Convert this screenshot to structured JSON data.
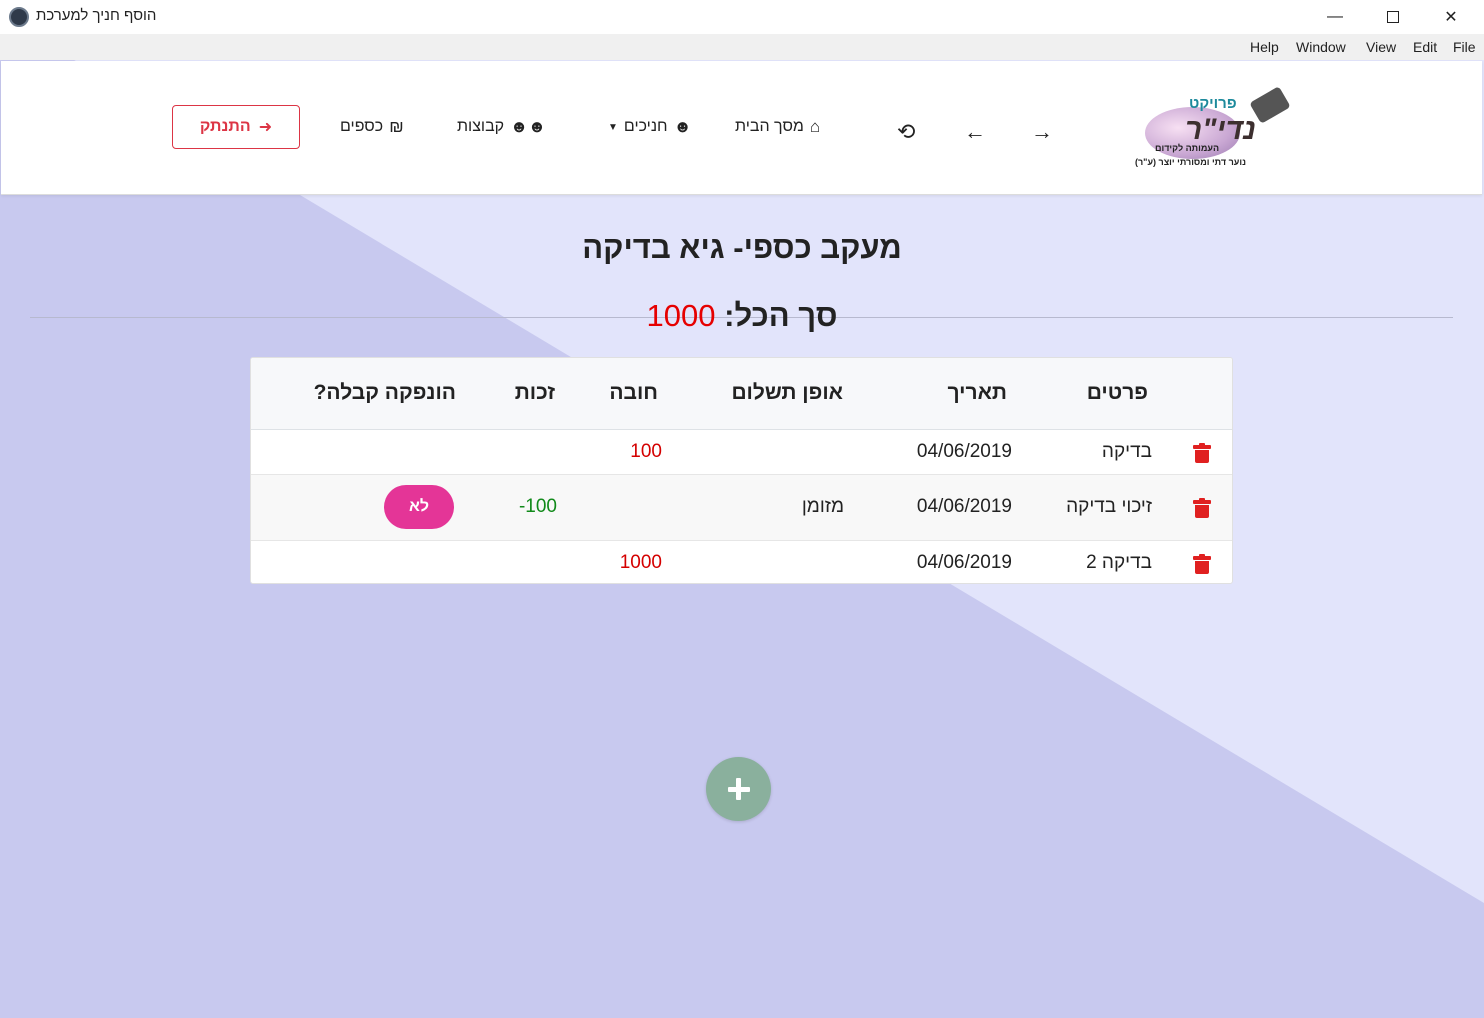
{
  "window": {
    "title": "הוסף חניך למערכת",
    "menu": [
      "Help",
      "Window",
      "View",
      "Edit",
      "File"
    ]
  },
  "navbar": {
    "logo": {
      "brand_top": "פרויקט",
      "brand_main": "נדי\"ר",
      "tagline1": "העמותה לקידום",
      "tagline2": "נוער דתי ומסורתי יוצר (ע\"ר)"
    },
    "home_label": "מסך הבית",
    "trainees_label": "חניכים",
    "groups_label": "קבוצות",
    "money_label": "כספים",
    "logout_label": "התנתק"
  },
  "page": {
    "title": "מעקב כספי- גיא בדיקה",
    "total_label": "סך הכל:",
    "total_value": "1000"
  },
  "table": {
    "headers": {
      "details": "פרטים",
      "date": "תאריך",
      "payment_method": "אופן תשלום",
      "debt": "חובה",
      "credit": "זכות",
      "receipt": "הונפקה קבלה?"
    },
    "rows": [
      {
        "details": "בדיקה",
        "date": "04/06/2019",
        "payment_method": "",
        "debt": "100",
        "credit": "",
        "receipt": ""
      },
      {
        "details": "זיכוי בדיקה",
        "date": "04/06/2019",
        "payment_method": "מזומן",
        "debt": "",
        "credit": "100-",
        "receipt": "לא"
      },
      {
        "details": "בדיקה 2",
        "date": "04/06/2019",
        "payment_method": "",
        "debt": "1000",
        "credit": "",
        "receipt": ""
      }
    ]
  },
  "colors": {
    "debt": "#d40000",
    "credit": "#118a1a",
    "receipt_pill": "#e43597",
    "fab": "#8ab09d",
    "logout": "#dc3545"
  },
  "icons": {
    "home": "home-icon",
    "trainees": "user-icon",
    "groups": "users-icon",
    "money": "shekel-icon",
    "logout": "sign-out-icon",
    "delete": "trash-icon",
    "add": "plus-icon"
  }
}
